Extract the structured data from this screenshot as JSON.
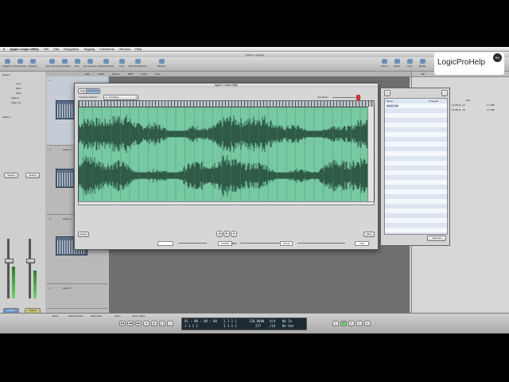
{
  "menubar": {
    "app": "Apple Loops Utility",
    "items": [
      "File",
      "Edit",
      "Navigation",
      "Tagging",
      "Transients",
      "Window",
      "Help"
    ]
  },
  "window_title": "Untitled - Arrange",
  "toolbar": {
    "buttons": [
      "Inspector",
      "Preferences",
      "Settings",
      "Auto Zoom",
      "Automation",
      "Flex",
      "Set Locators",
      "Repeat Section",
      "Crop",
      "Split by Playhead",
      "Bounce",
      "Colors",
      "Notes",
      "Lists",
      "Media"
    ]
  },
  "arrange_menu": [
    "Edit",
    "Track",
    "Region",
    "MIDI",
    "Audio",
    "View"
  ],
  "inspector": {
    "region_header": "Region",
    "track_header": "Audio 1",
    "params": [
      "Loop",
      "Mute",
      "Gain",
      "Fade In",
      "Fade Out"
    ],
    "setting_left": "Setting",
    "setting_right": "Setting",
    "channel_left": "Audio 1",
    "channel_right": "Output"
  },
  "tracks": [
    {
      "number": "1",
      "name": "Audio 1"
    },
    {
      "number": "2",
      "name": "Audio 2"
    },
    {
      "number": "3",
      "name": "Audio 3"
    },
    {
      "number": "4",
      "name": "Audio 4"
    }
  ],
  "right_panel": {
    "tabs": [
      "Bin",
      "Loops",
      "Library",
      "Browser"
    ],
    "column_size": "Size",
    "rows": [
      {
        "date": "12.08.11, 13:",
        "size": "2.4 MB"
      },
      {
        "date": "12.08.11, 13:",
        "size": "1.6 MB"
      }
    ]
  },
  "bottom_tabs": [
    "Mixer",
    "Sample Editor",
    "Piano Roll",
    "Score",
    "Hyper Editor"
  ],
  "lcd": {
    "smpte": "01 : 00 : 00 : 00",
    "bars": "1 1 1 1",
    "bars2": "1 1 1 1",
    "tempo": "120.0000",
    "tempo_sub": "227",
    "signature": "4/4",
    "division": "/16",
    "in": "No In",
    "out": "No Out"
  },
  "dialog": {
    "title": "Apple Loops Utility",
    "tabs": [
      "Tags",
      "Transients"
    ],
    "division_label": "Transient Division:",
    "division_value": "1 / 16 Notes",
    "sensitivity_label": "Sensitivity:",
    "assets_button": "Assets",
    "save_button": "Save",
    "zoom_value": "100000",
    "tempo_field": "120.00",
    "bpm_label": "BPM",
    "pitch_field": "0.00"
  },
  "file_window": {
    "column_name": "Name",
    "column_changed": "Changed",
    "file": "Remix 1.aif",
    "button": "Save All"
  },
  "logo": {
    "text": "LogicProHelp",
    "badge": "RU"
  },
  "colors": {
    "waveform_bg": "#77c9a1",
    "waveform_fg": "#2f5a46",
    "region": "#5d6f86",
    "logo_text": "#222222"
  }
}
